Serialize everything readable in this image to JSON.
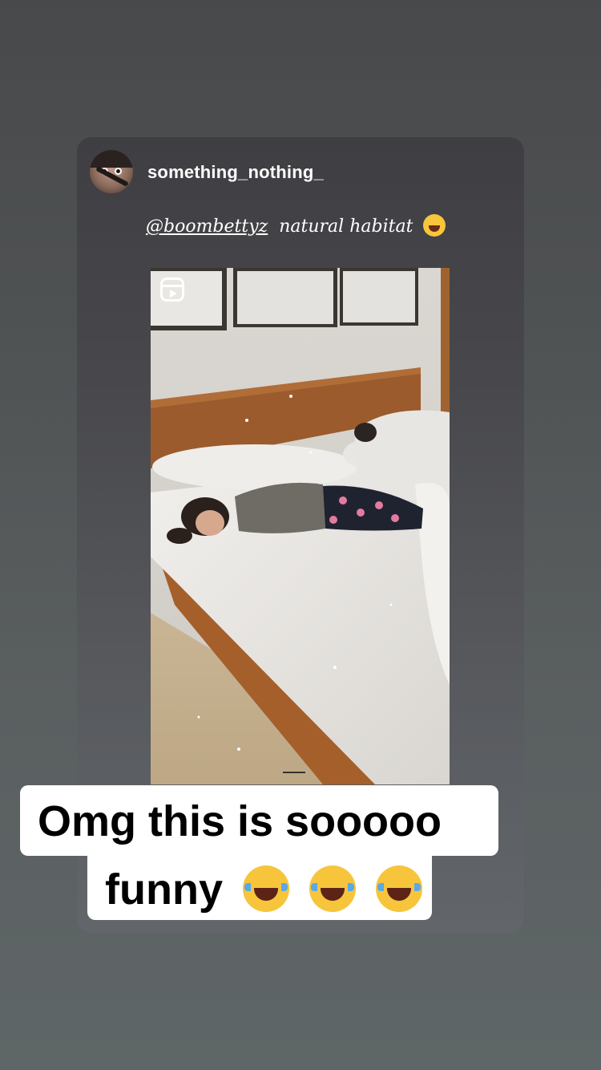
{
  "post": {
    "username": "something_nothing_",
    "caption": {
      "mention": "@boombettyz",
      "text": "natural habitat",
      "emoji_name": "rolling-laughing-emoji"
    },
    "media_type": "reel",
    "media_icon": "reels-icon"
  },
  "overlay": {
    "line1": "Omg this is sooooo",
    "line2": "funny",
    "emojis": [
      "tears-of-joy-emoji",
      "tears-of-joy-emoji",
      "tears-of-joy-emoji"
    ]
  }
}
